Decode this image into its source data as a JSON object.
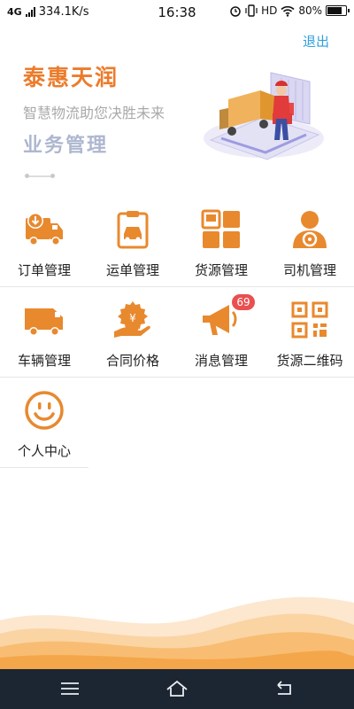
{
  "status_bar": {
    "network": "4G",
    "speed": "334.1K/s",
    "time": "16:38",
    "hd": "HD",
    "battery": "80%",
    "battery_level": 0.8
  },
  "header": {
    "logout_label": "退出"
  },
  "banner": {
    "brand": "泰惠天润",
    "slogan": "智慧物流助您决胜未来",
    "section_title": "业务管理"
  },
  "menu": [
    {
      "label": "订单管理",
      "icon": "truck-download-icon"
    },
    {
      "label": "运单管理",
      "icon": "clipboard-car-icon"
    },
    {
      "label": "货源管理",
      "icon": "cargo-grid-icon"
    },
    {
      "label": "司机管理",
      "icon": "driver-icon"
    },
    {
      "label": "车辆管理",
      "icon": "van-icon"
    },
    {
      "label": "合同价格",
      "icon": "hand-coin-icon"
    },
    {
      "label": "消息管理",
      "icon": "megaphone-icon",
      "badge": "69"
    },
    {
      "label": "货源二维码",
      "icon": "qr-code-icon"
    },
    {
      "label": "个人中心",
      "icon": "smiley-icon"
    }
  ],
  "colors": {
    "accent": "#ec7c2c",
    "icon": "#e8892e",
    "link": "#2f9fe0",
    "badge": "#e95050",
    "navbar": "#1c2532"
  }
}
